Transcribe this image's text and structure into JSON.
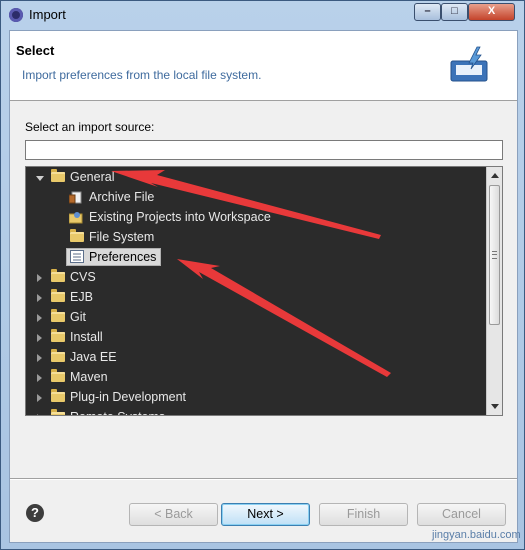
{
  "window": {
    "title": "Import",
    "controls": {
      "minimize": "–",
      "maximize": "□",
      "close": "X"
    }
  },
  "header": {
    "title": "Select",
    "description": "Import preferences from the local file system."
  },
  "source_label": "Select an import source:",
  "filter": {
    "value": "",
    "placeholder": ""
  },
  "tree": {
    "groups": [
      {
        "label": "General",
        "expanded": true,
        "children": [
          "Archive File",
          "Existing Projects into Workspace",
          "File System",
          "Preferences"
        ],
        "selected": "Preferences"
      },
      {
        "label": "CVS",
        "expanded": false
      },
      {
        "label": "EJB",
        "expanded": false
      },
      {
        "label": "Git",
        "expanded": false
      },
      {
        "label": "Install",
        "expanded": false
      },
      {
        "label": "Java EE",
        "expanded": false
      },
      {
        "label": "Maven",
        "expanded": false
      },
      {
        "label": "Plug-in Development",
        "expanded": false
      },
      {
        "label": "Remote Systems",
        "expanded": false
      }
    ]
  },
  "buttons": {
    "help": "?",
    "back": "< Back",
    "next": "Next >",
    "finish": "Finish",
    "cancel": "Cancel"
  },
  "watermark": "jingyan.baidu.com",
  "colors": {
    "annotation_arrow": "#e8393a",
    "tree_background": "#2b2b2b",
    "header_description": "#3f6b9e"
  }
}
